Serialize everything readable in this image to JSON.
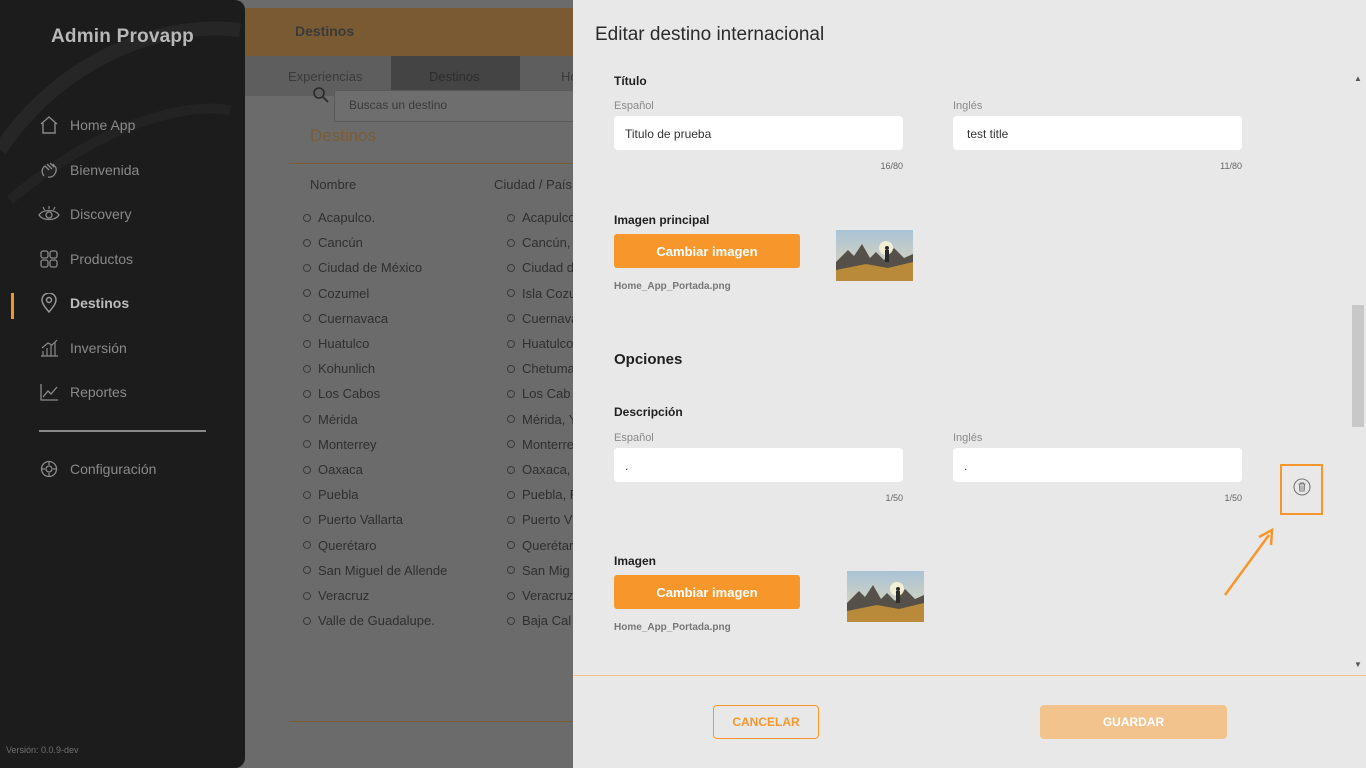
{
  "sidebar": {
    "brand": "Admin Provapp",
    "items": [
      {
        "label": "Home App",
        "icon": "home-icon"
      },
      {
        "label": "Bienvenida",
        "icon": "wave-hand-icon"
      },
      {
        "label": "Discovery",
        "icon": "eye-icon"
      },
      {
        "label": "Productos",
        "icon": "grid-icon"
      },
      {
        "label": "Destinos",
        "icon": "location-pin-icon",
        "active": true
      },
      {
        "label": "Inversión",
        "icon": "bar-chart-icon"
      },
      {
        "label": "Reportes",
        "icon": "line-chart-icon"
      }
    ],
    "settings": {
      "label": "Configuración",
      "icon": "gear-icon"
    },
    "version": "Versión: 0.0.9-dev"
  },
  "background": {
    "header_title": "Destinos",
    "tabs": [
      "Experiencias",
      "Destinos",
      "Ho"
    ],
    "search_placeholder": "Buscas un destino",
    "section_title": "Destinos",
    "columns": [
      "Nombre",
      "Ciudad / País"
    ],
    "rows": [
      [
        "Acapulco.",
        "Acapulco"
      ],
      [
        "Cancún",
        "Cancún,"
      ],
      [
        "Ciudad de México",
        "Ciudad d"
      ],
      [
        "Cozumel",
        "Isla Cozu"
      ],
      [
        "Cuernavaca",
        "Cuernava"
      ],
      [
        "Huatulco",
        "Huatulco"
      ],
      [
        "Kohunlich",
        "Chetuma"
      ],
      [
        "Los Cabos",
        "Los Cab"
      ],
      [
        "Mérida",
        "Mérida, Y"
      ],
      [
        "Monterrey",
        "Monterre"
      ],
      [
        "Oaxaca",
        "Oaxaca,"
      ],
      [
        "Puebla",
        "Puebla, P"
      ],
      [
        "Puerto Vallarta",
        "Puerto V"
      ],
      [
        "Querétaro",
        "Querétar"
      ],
      [
        "San Miguel de Allende",
        "San Mig"
      ],
      [
        "Veracruz",
        "Veracruz"
      ],
      [
        "Valle de Guadalupe.",
        "Baja Cal"
      ]
    ]
  },
  "modal": {
    "title": "Editar destino internacional",
    "titulo_section": {
      "label": "Título",
      "es_label": "Español",
      "en_label": "Inglés",
      "es_value": "Titulo de prueba",
      "en_value": "test title",
      "es_count": "16/80",
      "en_count": "11/80"
    },
    "main_image": {
      "label": "Imagen principal",
      "button": "Cambiar imagen",
      "filename": "Home_App_Portada.png"
    },
    "options_title": "Opciones",
    "description": {
      "label": "Descripción",
      "es_label": "Español",
      "en_label": "Inglés",
      "es_value": ".",
      "en_value": ".",
      "es_count": "1/50",
      "en_count": "1/50"
    },
    "image": {
      "label": "Imagen",
      "button": "Cambiar imagen",
      "filename": "Home_App_Portada.png"
    },
    "cancel": "CANCELAR",
    "save": "GUARDAR"
  },
  "colors": {
    "accent": "#f7962b",
    "sidebar_bg": "#1c1c1c",
    "panel_bg": "#e8e8e8"
  }
}
